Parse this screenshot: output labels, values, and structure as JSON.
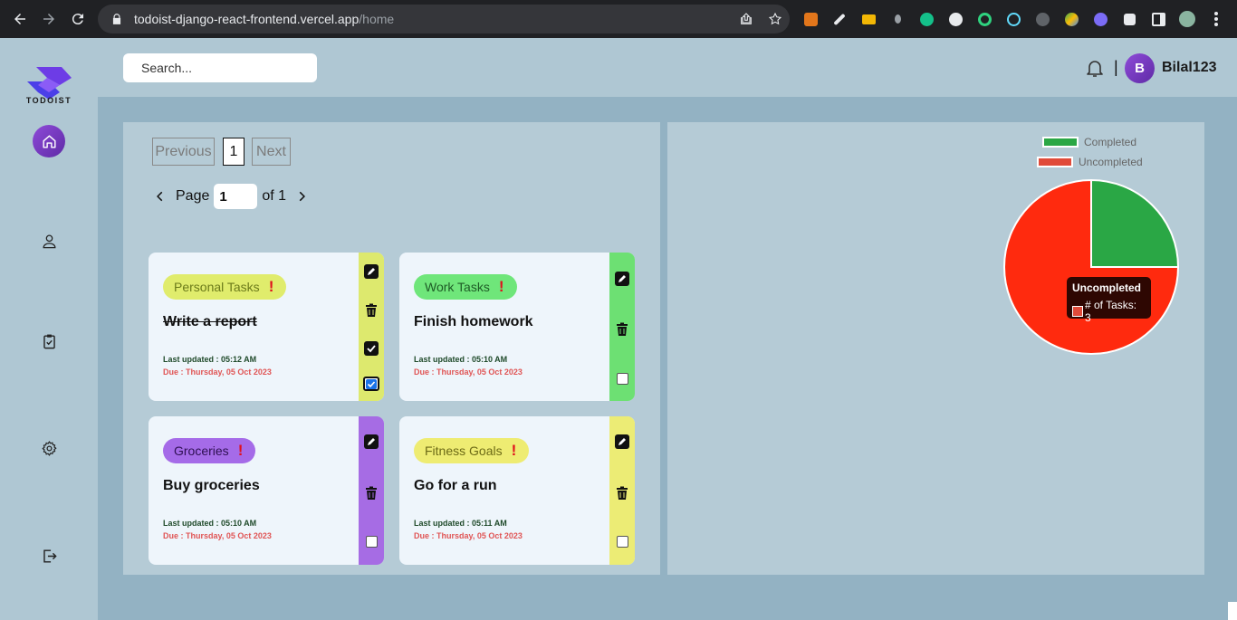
{
  "browser": {
    "url_host": "todoist-django-react-frontend.vercel.app",
    "url_path": "/home"
  },
  "sidebar": {
    "logo_text": "TODOIST",
    "items": [
      {
        "name": "home",
        "icon": "home-icon",
        "active": true
      },
      {
        "name": "profile",
        "icon": "user-icon",
        "active": false
      },
      {
        "name": "tasks",
        "icon": "clipboard-check-icon",
        "active": false
      },
      {
        "name": "settings",
        "icon": "gear-icon",
        "active": false
      },
      {
        "name": "logout",
        "icon": "logout-icon",
        "active": false
      }
    ]
  },
  "header": {
    "search_placeholder": "Search...",
    "separator": "|",
    "avatar_initial": "B",
    "username": "Bilal123"
  },
  "pagination": {
    "previous_label": "Previous",
    "current_page": "1",
    "next_label": "Next",
    "page_label": "Page",
    "page_input_value": "1",
    "of_label": "of 1"
  },
  "tasks": [
    {
      "category": "Personal Tasks",
      "priority_mark": "!",
      "title": "Write a report",
      "completed": true,
      "updated": "Last updated : 05:12 AM",
      "due": "Due : Thursday, 05 Oct 2023",
      "tag_color": "#e0ec6c",
      "tag_text_color": "#6b7a1a",
      "strip_color": "#dde96e"
    },
    {
      "category": "Work Tasks",
      "priority_mark": "!",
      "title": "Finish homework",
      "completed": false,
      "updated": "Last updated : 05:10 AM",
      "due": "Due : Thursday, 05 Oct 2023",
      "tag_color": "#6fe67a",
      "tag_text_color": "#1e5b26",
      "strip_color": "#6de073"
    },
    {
      "category": "Groceries",
      "priority_mark": "!",
      "title": "Buy groceries",
      "completed": false,
      "updated": "Last updated : 05:10 AM",
      "due": "Due : Thursday, 05 Oct 2023",
      "tag_color": "#a56be8",
      "tag_text_color": "#2e0f52",
      "strip_color": "#a66ce4"
    },
    {
      "category": "Fitness Goals",
      "priority_mark": "!",
      "title": "Go for a run",
      "completed": false,
      "updated": "Last updated : 05:11 AM",
      "due": "Due : Thursday, 05 Oct 2023",
      "tag_color": "#eeec72",
      "tag_text_color": "#6c6a16",
      "strip_color": "#ecec75"
    }
  ],
  "chart_data": {
    "type": "pie",
    "title": "",
    "labels": [
      "Completed",
      "Uncompleted"
    ],
    "values": [
      1,
      3
    ],
    "colors": [
      "#2aa745",
      "#ff2a0e"
    ],
    "legend_swatch_colors": [
      "#2aa745",
      "#e04b3a"
    ],
    "legend_position": "top-right",
    "tooltip": {
      "title": "Uncompleted",
      "label": "# of Tasks: 3"
    }
  }
}
